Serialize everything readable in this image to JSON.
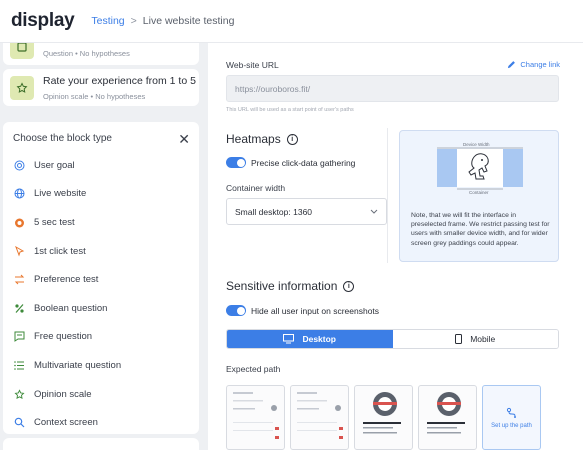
{
  "header": {
    "logo": "display",
    "breadcrumb": [
      "Testing",
      "Live website testing"
    ]
  },
  "sidebar": {
    "top_card": {
      "subtitle": "Question • No hypotheses"
    },
    "rate_card": {
      "title": "Rate your experience from 1 to 5 st...",
      "subtitle": "Opinion scale • No hypotheses"
    },
    "chooser_title": "Choose the block type",
    "block_types": [
      {
        "label": "User goal",
        "icon": "target-icon",
        "color": "#3c7ee6"
      },
      {
        "label": "Live website",
        "icon": "globe-icon",
        "color": "#3c7ee6"
      },
      {
        "label": "5 sec test",
        "icon": "timer-icon",
        "color": "#e8772e"
      },
      {
        "label": "1st click test",
        "icon": "cursor-icon",
        "color": "#e8772e"
      },
      {
        "label": "Preference test",
        "icon": "swap-icon",
        "color": "#e8772e"
      },
      {
        "label": "Boolean question",
        "icon": "percent-icon",
        "color": "#3d8a3a"
      },
      {
        "label": "Free question",
        "icon": "comment-icon",
        "color": "#3d8a3a"
      },
      {
        "label": "Multivariate question",
        "icon": "list-icon",
        "color": "#3d8a3a"
      },
      {
        "label": "Opinion scale",
        "icon": "star-icon",
        "color": "#3d8a3a"
      },
      {
        "label": "Context screen",
        "icon": "search-icon",
        "color": "#3c7ee6"
      }
    ]
  },
  "main": {
    "website_url_label": "Web-site URL",
    "change_link": "Change link",
    "url_value": "https://ouroboros.fit/",
    "url_hint": "This URL will be used as a start point of user's paths",
    "heatmaps_title": "Heatmaps",
    "precise_click_label": "Precise click-data gathering",
    "container_width_label": "Container width",
    "container_width_value": "Small desktop: 1360",
    "preview": {
      "device_width_label": "Device Width",
      "container_label": "Container",
      "note": "Note, that we will fit the interface in preselected frame. We restrict passing test for users with smaller device width, and for wider screen grey paddings could appear."
    },
    "sensitive_title": "Sensitive information",
    "hide_input_label": "Hide all user input on screenshots",
    "segments": {
      "desktop": "Desktop",
      "mobile": "Mobile"
    },
    "expected_path_label": "Expected path",
    "setup_path_label": "Set up the path"
  },
  "colors": {
    "accent": "#3c7ee6",
    "sidebar_bg": "#eef0f3",
    "card_icon_bg": "#dfe9b2"
  }
}
